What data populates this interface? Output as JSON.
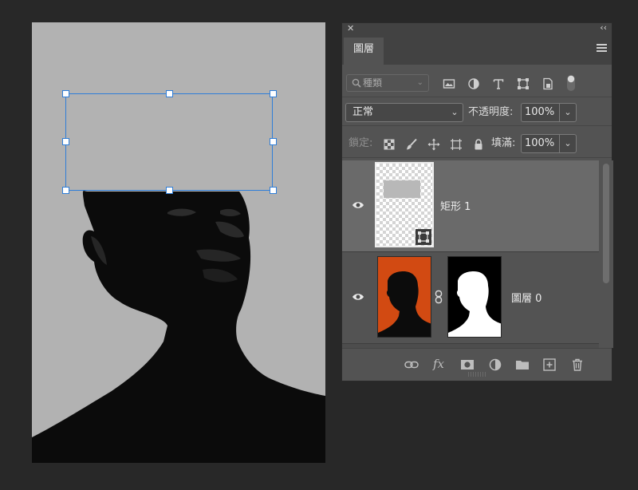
{
  "panel": {
    "close_symbol": "✕",
    "collapse_symbol": "‹‹",
    "tab_label": "圖層",
    "menu_icon": "hamburger-menu-icon"
  },
  "filter": {
    "search_label": "種類",
    "search_icon": "magnifier-icon",
    "icons": [
      "image-filter-icon",
      "adjustment-filter-icon",
      "type-filter-icon",
      "shape-filter-icon",
      "smart-object-filter-icon",
      "filter-toggle-icon"
    ]
  },
  "blend": {
    "mode": "正常",
    "opacity_label": "不透明度:",
    "opacity_value": "100%"
  },
  "lock": {
    "label": "鎖定:",
    "icons": [
      "lock-transparent-pixels-icon",
      "lock-image-pixels-icon",
      "lock-position-icon",
      "lock-artboard-icon",
      "lock-all-icon"
    ],
    "fill_label": "填滿:",
    "fill_value": "100%"
  },
  "layers": [
    {
      "name": "矩形 1",
      "visible": true,
      "selected": true,
      "type": "shape"
    },
    {
      "name": "圖層 0",
      "visible": true,
      "selected": false,
      "type": "pixel-with-mask"
    }
  ],
  "bottom_icons": [
    "link-layers-icon",
    "fx-icon",
    "add-mask-icon",
    "new-adjustment-layer-icon",
    "new-group-folder-icon",
    "new-layer-icon",
    "trash-icon"
  ],
  "bottom_fx_label": "fx",
  "colors": {
    "selection_blue": "#2f7ed8",
    "panel_bg": "#535353",
    "selected_layer_bg": "#6a6a6a",
    "canvas_gray": "#b2b2b2",
    "thumb_orange": "#d24a12"
  }
}
